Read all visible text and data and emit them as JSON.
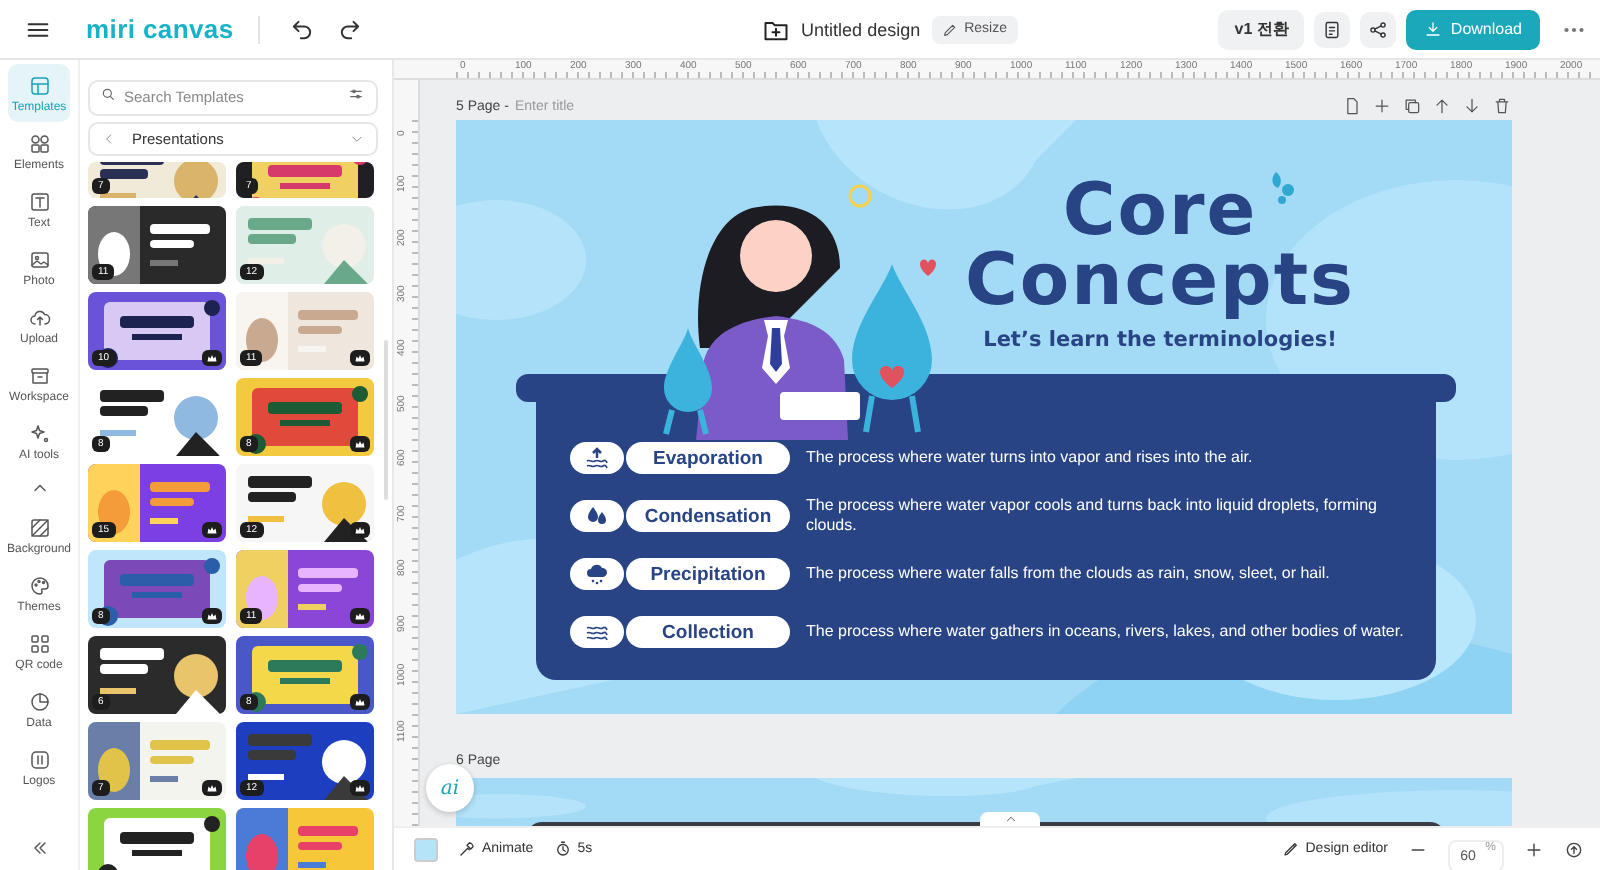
{
  "topbar": {
    "logo": "miri canvas",
    "document_title": "Untitled design",
    "resize": "Resize",
    "version_button": "v1 전환",
    "download": "Download"
  },
  "rail": {
    "top": [
      {
        "label": "Templates",
        "selected": true
      },
      {
        "label": "Elements",
        "selected": false
      },
      {
        "label": "Text",
        "selected": false
      },
      {
        "label": "Photo",
        "selected": false
      },
      {
        "label": "Upload",
        "selected": false
      },
      {
        "label": "Workspace",
        "selected": false
      },
      {
        "label": "AI tools",
        "selected": false
      }
    ],
    "bottom": [
      {
        "label": "Background",
        "selected": false
      },
      {
        "label": "Themes",
        "selected": false
      },
      {
        "label": "QR code",
        "selected": false
      },
      {
        "label": "Data",
        "selected": false
      },
      {
        "label": "Logos",
        "selected": false
      }
    ]
  },
  "templates_panel": {
    "search": {
      "placeholder": "Search Templates"
    },
    "category": "Presentations",
    "thumbnails": [
      {
        "kind": "picture",
        "pages": "7",
        "premium": false
      },
      {
        "kind": "picture",
        "pages": "7",
        "premium": false
      },
      {
        "kind": "picture",
        "pages": "11",
        "premium": false
      },
      {
        "kind": "picture",
        "pages": "12",
        "premium": false
      },
      {
        "kind": "picture",
        "pages": "10",
        "premium": true
      },
      {
        "kind": "picture",
        "pages": "11",
        "premium": true
      },
      {
        "kind": "picture",
        "pages": "8",
        "premium": false
      },
      {
        "kind": "picture",
        "pages": "8",
        "premium": true
      },
      {
        "kind": "picture",
        "pages": "15",
        "premium": true
      },
      {
        "kind": "picture",
        "pages": "12",
        "premium": true
      },
      {
        "kind": "picture",
        "pages": "8",
        "premium": true
      },
      {
        "kind": "picture",
        "pages": "11",
        "premium": true
      },
      {
        "kind": "picture",
        "pages": "6",
        "premium": false
      },
      {
        "kind": "picture",
        "pages": "8",
        "premium": true
      },
      {
        "kind": "picture",
        "pages": "7",
        "premium": true
      },
      {
        "kind": "picture",
        "pages": "12",
        "premium": true
      },
      {
        "kind": "picture",
        "premium": false
      },
      {
        "kind": "picture",
        "premium": false
      }
    ]
  },
  "rulers": {
    "horizontal": [
      "0",
      "100",
      "200",
      "300",
      "400",
      "500",
      "600",
      "700",
      "800",
      "900",
      "1000",
      "1100",
      "1200",
      "1300",
      "1400",
      "1500",
      "1600",
      "1700",
      "1800",
      "1900",
      "2000"
    ],
    "vertical": [
      "0",
      "100",
      "200",
      "300",
      "400",
      "500",
      "600",
      "700",
      "800",
      "900",
      "1000",
      "1100"
    ]
  },
  "pages": [
    {
      "label": "5 Page -",
      "title_placeholder": "Enter title",
      "slide": {
        "title_lines": [
          "Core",
          "Concepts"
        ],
        "subtitle": "Let’s learn the terminologies!",
        "terms": [
          {
            "term": "Evaporation",
            "definition": "The process where water turns into vapor and rises into the air."
          },
          {
            "term": "Condensation",
            "definition": "The process where water vapor cools and turns back into liquid droplets, forming clouds."
          },
          {
            "term": "Precipitation",
            "definition": "The process where water falls from the clouds as rain, snow, sleet, or hail."
          },
          {
            "term": "Collection",
            "definition": "The process where water gathers in oceans, rivers, lakes, and other bodies of water."
          }
        ]
      }
    },
    {
      "label": "6 Page"
    }
  ],
  "ai_button": "ai",
  "bottom_bar": {
    "animate": "Animate",
    "duration": "5s",
    "design_editor": "Design editor",
    "zoom": "60",
    "zoom_unit": "%"
  }
}
